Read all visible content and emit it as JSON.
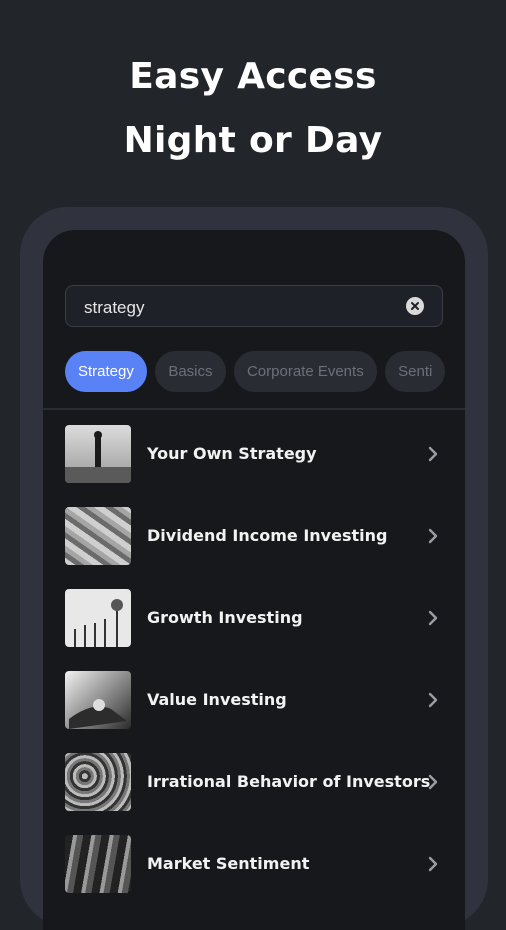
{
  "headline": {
    "line1": "Easy Access",
    "line2": "Night or Day"
  },
  "search": {
    "value": "strategy",
    "clear_icon": "clear-icon"
  },
  "chips": [
    {
      "label": "Strategy",
      "active": true
    },
    {
      "label": "Basics",
      "active": false
    },
    {
      "label": "Corporate Events",
      "active": false
    },
    {
      "label": "Senti",
      "active": false
    }
  ],
  "list": [
    {
      "title": "Your Own Strategy"
    },
    {
      "title": "Dividend Income Investing"
    },
    {
      "title": "Growth Investing"
    },
    {
      "title": "Value Investing"
    },
    {
      "title": "Irrational Behavior of Investors"
    },
    {
      "title": "Market Sentiment"
    }
  ],
  "colors": {
    "background": "#222529",
    "frame": "#30333d",
    "screen": "#17181c",
    "accent": "#5a82f7"
  }
}
